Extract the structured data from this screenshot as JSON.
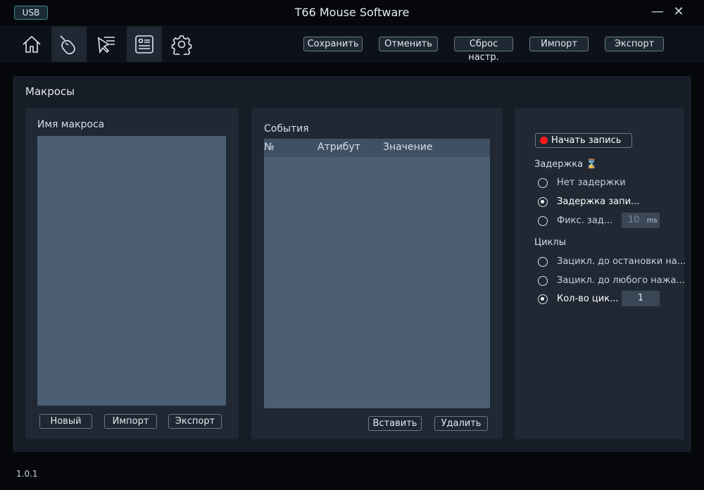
{
  "window": {
    "badge": "USB",
    "title": "T66 Mouse Software",
    "minimize": "—",
    "close": "✕"
  },
  "toolbar": {
    "save": "Сохранить",
    "cancel": "Отменить",
    "reset": "Сброс настр.",
    "import": "Импорт",
    "export": "Экспорт"
  },
  "section_title": "Макросы",
  "macro_panel": {
    "title": "Имя макроса",
    "new": "Новый",
    "import": "Импорт",
    "export": "Экспорт"
  },
  "events_panel": {
    "title": "События",
    "columns": [
      "№",
      "Атрибут",
      "Значение"
    ],
    "insert": "Вставить",
    "delete": "Удалить"
  },
  "record_panel": {
    "record": "Начать запись",
    "delay_title": "Задержка",
    "delay_icon": "⌛",
    "delay_options": [
      "Нет задержки",
      "Задержка запи...",
      "Фикс. зад..."
    ],
    "delay_selected": 1,
    "fixed_delay_value": "10",
    "fixed_delay_unit": "ms",
    "cycles_title": "Циклы",
    "cycle_options": [
      "Зацикл. до остановки на...",
      "Зацикл. до любого нажа...",
      "Кол-во цик..."
    ],
    "cycles_selected": 2,
    "cycle_count": "1",
    "record_color": "#ff1a1a"
  },
  "version": "1.0.1"
}
